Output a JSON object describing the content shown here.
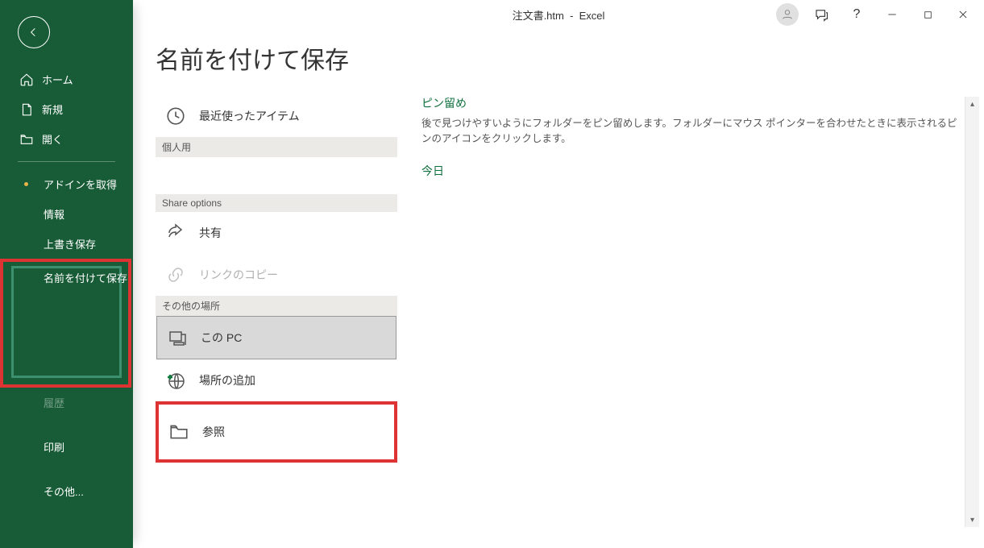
{
  "titlebar": {
    "filename": "注文書.htm",
    "app": "Excel"
  },
  "sidebar": {
    "home": "ホーム",
    "new": "新規",
    "open": "開く",
    "addins": "アドインを取得",
    "info": "情報",
    "save": "上書き保存",
    "saveas": "名前を付けて保存",
    "history": "履歴",
    "print": "印刷",
    "more": "その他..."
  },
  "page": {
    "title": "名前を付けて保存"
  },
  "locations": {
    "recent": "最近使ったアイテム",
    "personal_header": "個人用",
    "share_header": "Share options",
    "share": "共有",
    "copylink": "リンクのコピー",
    "other_header": "その他の場所",
    "thispc": "この PC",
    "addplace": "場所の追加",
    "browse": "参照"
  },
  "right": {
    "pin_title": "ピン留め",
    "pin_desc": "後で見つけやすいようにフォルダーをピン留めします。フォルダーにマウス ポインターを合わせたときに表示されるピンのアイコンをクリックします。",
    "today": "今日"
  }
}
